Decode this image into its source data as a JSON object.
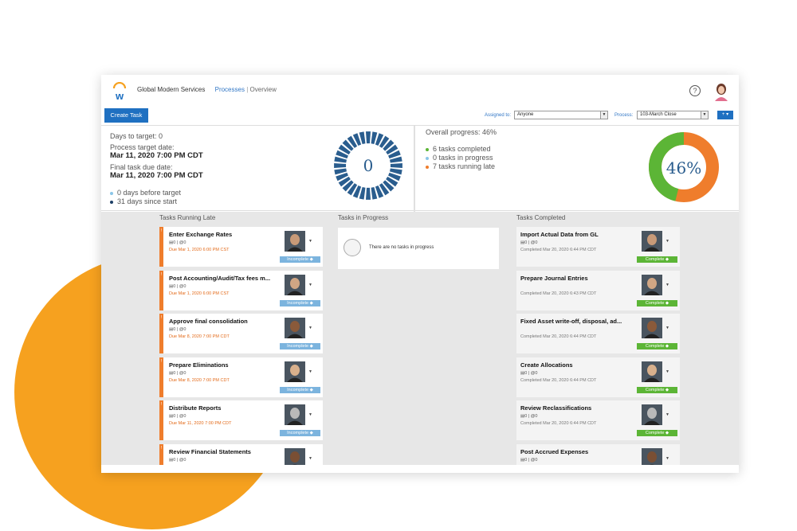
{
  "header": {
    "company": "Global Modern Services",
    "breadcrumb_link": "Processes",
    "breadcrumb_sep": "|",
    "breadcrumb_current": "Overview",
    "help_symbol": "?"
  },
  "toolbar": {
    "create_label": "Create Task",
    "assigned_label": "Assigned to:",
    "assigned_value": "Anyone",
    "process_label": "Process:",
    "process_value": "103-March Close",
    "add_label": "+ ▾"
  },
  "summary": {
    "days_to_target": "Days to target: 0",
    "target_date_label": "Process target date:",
    "target_date": "Mar 11, 2020 7:00 PM CDT",
    "final_due_label": "Final task due date:",
    "final_due": "Mar 11, 2020 7:00 PM CDT",
    "days_before": "0 days before target",
    "days_since": "31 days since start",
    "dial_value": "0",
    "overall_progress": "Overall progress: 46%",
    "completed": "6 tasks completed",
    "in_progress": "0 tasks in progress",
    "running_late": "7 tasks running late",
    "percent_label": "46%",
    "percent": 46
  },
  "colors": {
    "accent": "#1f70c1",
    "late": "#ef7d2c",
    "complete": "#5cb536",
    "dial": "#2a5d8e",
    "in_progress": "#8bc6e8"
  },
  "columns": {
    "late_title": "Tasks Running Late",
    "progress_title": "Tasks in Progress",
    "completed_title": "Tasks Completed",
    "empty_text": "There are no tasks in progress"
  },
  "late_tasks": [
    {
      "title": "Enter Exchange Rates",
      "counts": "▤0 | @0",
      "due": "Due Mar 1, 2020 6:00 PM CST",
      "status": "Incomplete ◆"
    },
    {
      "title": "Post Accounting/Audit/Tax fees m...",
      "counts": "▤0 | @0",
      "due": "Due Mar 1, 2020 6:00 PM CST",
      "status": "Incomplete ◆"
    },
    {
      "title": "Approve final consolidation",
      "counts": "▤0 | @0",
      "due": "Due Mar 8, 2020 7:00 PM CDT",
      "status": "Incomplete ◆"
    },
    {
      "title": "Prepare Eliminations",
      "counts": "▤0 | @0",
      "due": "Due Mar 8, 2020 7:00 PM CDT",
      "status": "Incomplete ◆"
    },
    {
      "title": "Distribute Reports",
      "counts": "▤0 | @0",
      "due": "Due Mar 11, 2020 7:00 PM CDT",
      "status": "Incomplete ◆"
    },
    {
      "title": "Review Financial Statements",
      "counts": "▤0 | @0",
      "due": "",
      "status": ""
    }
  ],
  "completed_tasks": [
    {
      "title": "Import Actual Data from GL",
      "counts": "▤0 | @0",
      "date": "Completed Mar 20, 2020 6:44 PM CDT",
      "status": "Complete ◆"
    },
    {
      "title": "Prepare Journal Entries",
      "counts": "",
      "date": "Completed Mar 20, 2020 6:43 PM CDT",
      "status": "Complete ◆"
    },
    {
      "title": "Fixed Asset write-off, disposal, ad...",
      "counts": "",
      "date": "Completed Mar 20, 2020 6:44 PM CDT",
      "status": "Complete ◆"
    },
    {
      "title": "Create Allocations",
      "counts": "▤0 | @0",
      "date": "Completed Mar 20, 2020 6:44 PM CDT",
      "status": "Complete ◆"
    },
    {
      "title": "Review Reclassifications",
      "counts": "▤0 | @0",
      "date": "Completed Mar 20, 2020 6:44 PM CDT",
      "status": "Complete ◆"
    },
    {
      "title": "Post Accrued Expenses",
      "counts": "▤0 | @0",
      "date": "",
      "status": ""
    }
  ]
}
